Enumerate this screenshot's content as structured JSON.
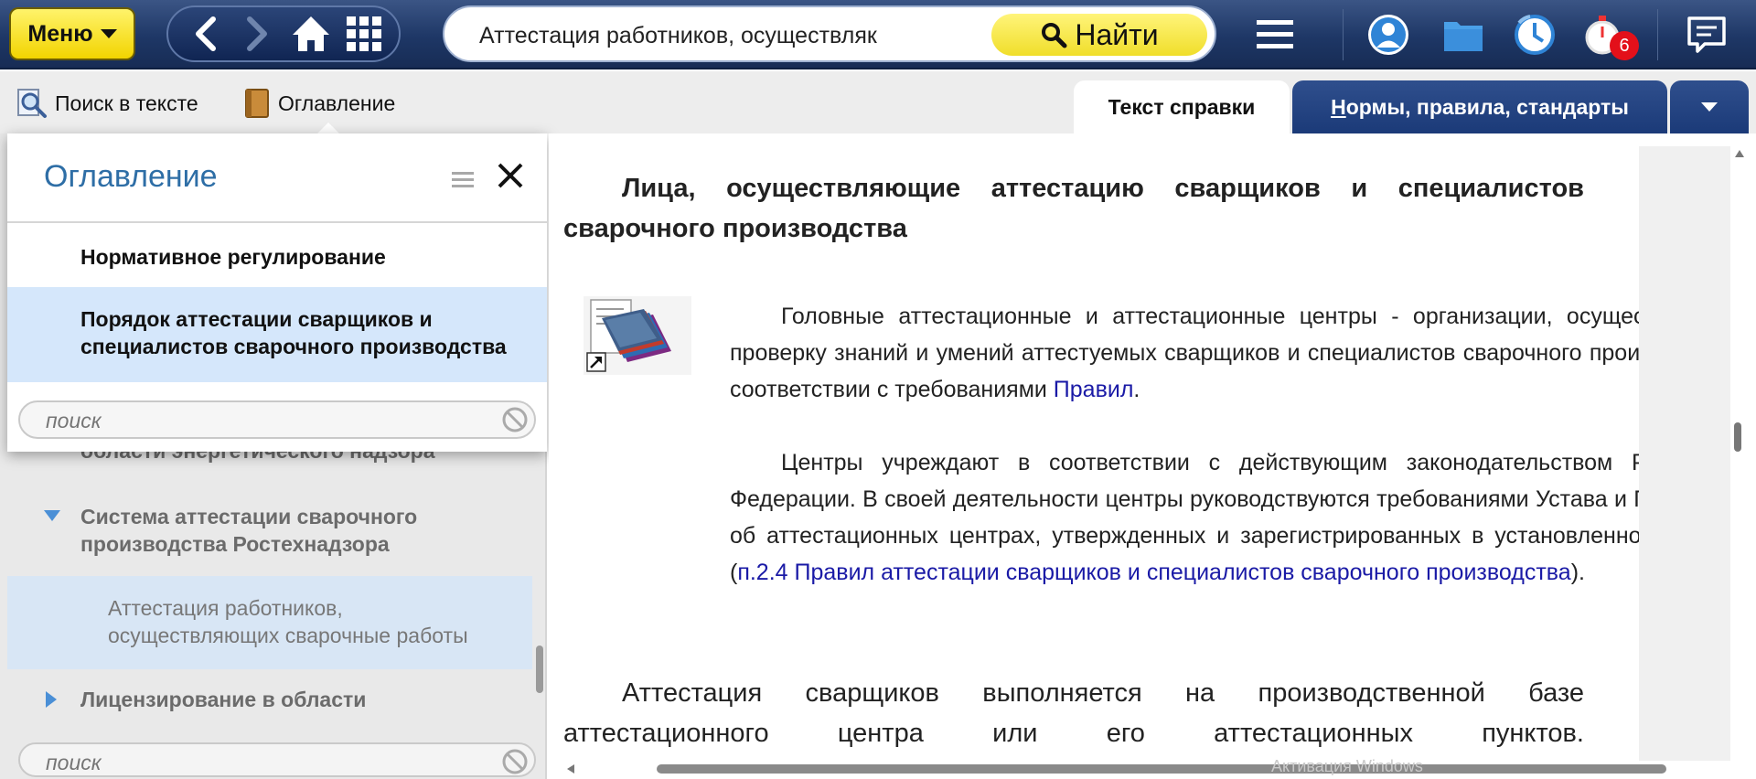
{
  "topbar": {
    "menu_label": "Меню",
    "search_value": "Аттестация работников, осуществляк",
    "find_label": "Найти",
    "notification_count": "6"
  },
  "subbar": {
    "text_search_label": "Поиск в тексте",
    "contents_label": "Оглавление"
  },
  "tabs": {
    "text_label": "Текст справки",
    "norms_first": "Н",
    "norms_rest": "ормы, правила, стандарты"
  },
  "toc": {
    "title": "Оглавление",
    "items": [
      {
        "label": "Нормативное регулирование"
      },
      {
        "label": "Порядок аттестации сварщиков и специалистов сварочного производства"
      }
    ],
    "search_placeholder": "поиск"
  },
  "left_panel": {
    "cut_item": "области энергетического надзора",
    "items": [
      {
        "label": "Система аттестации сварочного производства Ростехнадзора"
      },
      {
        "label": "Аттестация работников, осуществляющих сварочные работы"
      },
      {
        "label": "Лицензирование в области"
      }
    ],
    "search_placeholder": "поиск"
  },
  "document": {
    "heading": "Лица, осуществляющие аттестацию сварщиков и специалистов сварочного производства",
    "p1_text": "Головные аттестационные и аттестационные центры - организации, осуществляющие проверку знаний и умений аттестуемых сварщиков и специалистов сварочного производства в соответствии с требованиями ",
    "p1_link": "Правил",
    "p1_end": ".",
    "p2_text": "Центры учреждают в соответствии с действующим законодательством Российской Федерации. В своей деятельности центры руководствуются требованиями Устава и Положения об аттестационных центрах, утвержденных и зарегистрированных в установленном порядке (",
    "p2_link": "п.2.4 Правил аттестации сварщиков и специалистов сварочного производства",
    "p2_end": ").",
    "p3_text": "Аттестация сварщиков выполняется на производственной базе аттестационного центра или его аттестационных пунктов.",
    "watermark": "Активация Windows"
  }
}
